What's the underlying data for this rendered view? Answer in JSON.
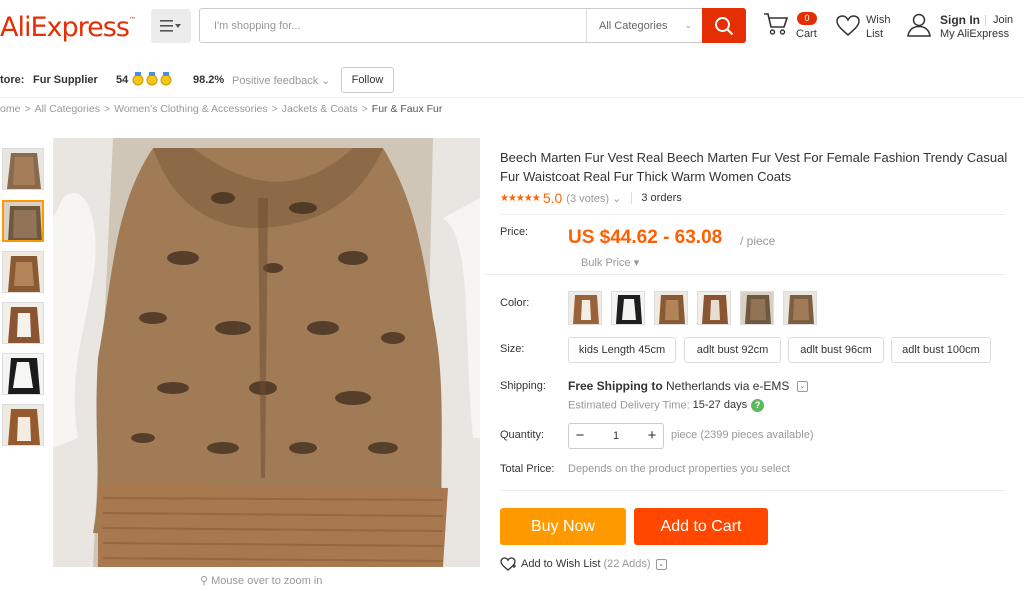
{
  "header": {
    "logo": "AliExpress",
    "trademark": "™",
    "search_placeholder": "I'm shopping for...",
    "category": "All Categories",
    "cart_count": "0",
    "cart_label": "Cart",
    "wish_label_1": "Wish",
    "wish_label_2": "List",
    "sign_in": "Sign In",
    "join": "Join",
    "my_ali": "My AliExpress"
  },
  "store": {
    "prefix": "tore:",
    "name": "Fur Supplier",
    "score": "54",
    "feedback_pct": "98.2%",
    "feedback_label": "Positive feedback",
    "follow": "Follow"
  },
  "breadcrumb": [
    "ome",
    "All Categories",
    "Women's Clothing & Accessories",
    "Jackets & Coats",
    "Fur & Faux Fur"
  ],
  "product": {
    "title": "Beech Marten Fur Vest Real Beech Marten Fur Vest For Female Fashion Trendy Casual Fur Waistcoat Real Fur Thick Warm Women Coats",
    "rating": "5.0",
    "votes": "(3 votes)",
    "orders": "3 orders",
    "price_label": "Price:",
    "price": "US $44.62 - 63.08",
    "price_unit": "/ piece",
    "bulk": "Bulk Price",
    "color_label": "Color:",
    "size_label": "Size:",
    "sizes": [
      "kids Length 45cm",
      "adlt bust 92cm",
      "adlt bust 96cm",
      "adlt bust 100cm"
    ],
    "shipping_label": "Shipping:",
    "shipping_free": "Free Shipping to",
    "shipping_dest": "Netherlands via e-EMS",
    "eta_label": "Estimated Delivery Time:",
    "eta_days": "15-27 days",
    "qty_label": "Quantity:",
    "qty": "1",
    "avail": "piece (2399 pieces available)",
    "total_label": "Total Price:",
    "total_hint": "Depends on the product properties you select",
    "buy_now": "Buy Now",
    "add_to_cart": "Add to Cart",
    "wish": "Add to Wish List",
    "wish_count": "(22 Adds)",
    "zoom_hint": "Mouse over to zoom in"
  },
  "colors": {
    "brand": "#e62e04",
    "buy": "#ff9900",
    "cart": "#ff4700"
  }
}
